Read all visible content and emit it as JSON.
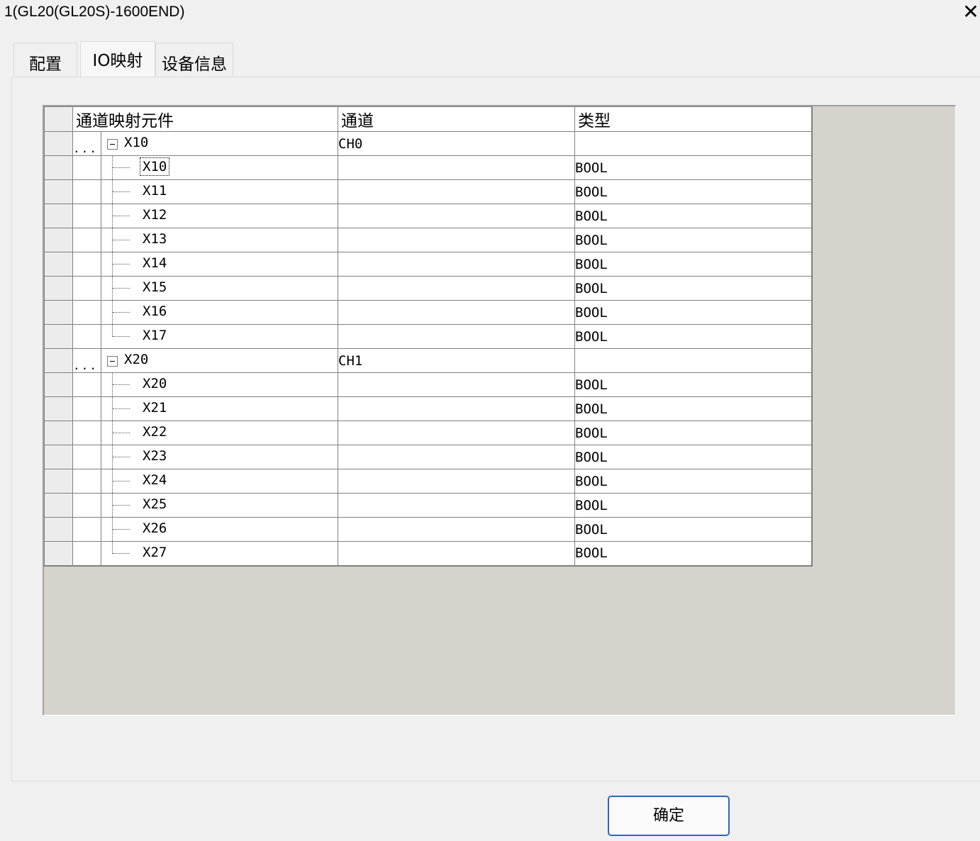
{
  "window": {
    "title": "1(GL20(GL20S)-1600END)",
    "close_symbol": "✕"
  },
  "tabs": [
    {
      "label": "配置",
      "active": false
    },
    {
      "label": "IO映射",
      "active": true
    },
    {
      "label": "设备信息",
      "active": false
    }
  ],
  "grid": {
    "columns": [
      "通道映射元件",
      "通道",
      "类型"
    ],
    "groups": [
      {
        "element": "X10",
        "channel": "CH0",
        "children": [
          {
            "element": "X10",
            "type": "BOOL"
          },
          {
            "element": "X11",
            "type": "BOOL"
          },
          {
            "element": "X12",
            "type": "BOOL"
          },
          {
            "element": "X13",
            "type": "BOOL"
          },
          {
            "element": "X14",
            "type": "BOOL"
          },
          {
            "element": "X15",
            "type": "BOOL"
          },
          {
            "element": "X16",
            "type": "BOOL"
          },
          {
            "element": "X17",
            "type": "BOOL"
          }
        ]
      },
      {
        "element": "X20",
        "channel": "CH1",
        "children": [
          {
            "element": "X20",
            "type": "BOOL"
          },
          {
            "element": "X21",
            "type": "BOOL"
          },
          {
            "element": "X22",
            "type": "BOOL"
          },
          {
            "element": "X23",
            "type": "BOOL"
          },
          {
            "element": "X24",
            "type": "BOOL"
          },
          {
            "element": "X25",
            "type": "BOOL"
          },
          {
            "element": "X26",
            "type": "BOOL"
          },
          {
            "element": "X27",
            "type": "BOOL"
          }
        ]
      }
    ],
    "parent_dots": "...",
    "focused_row": "X10"
  },
  "buttons": {
    "ok_label": "确定"
  },
  "colors": {
    "grid_background": "#d6d2cc",
    "button_border": "#2b68b6"
  }
}
